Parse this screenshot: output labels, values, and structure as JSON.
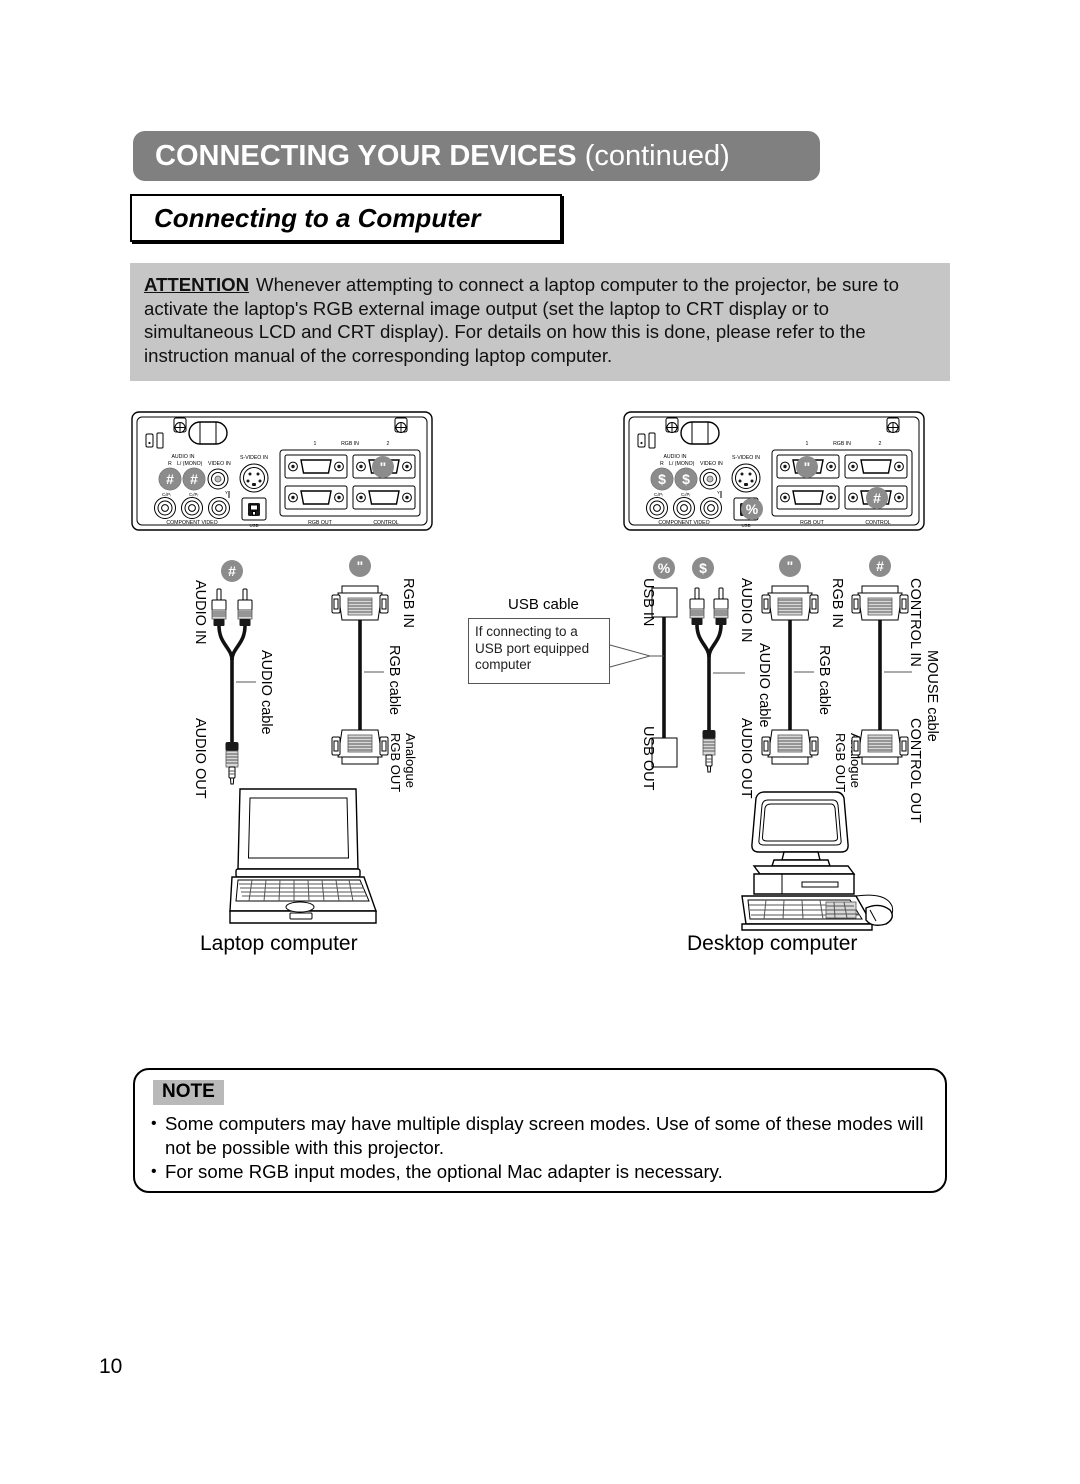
{
  "header": {
    "banner_title_main": "CONNECTING YOUR DEVICES",
    "banner_title_continued": " (continued)",
    "section_title": "Connecting to a Computer"
  },
  "attention": {
    "label": "ATTENTION",
    "body": "Whenever attempting to connect a laptop computer to the projector, be sure to activate the laptop's RGB external image output (set the laptop to CRT display or to simultaneous LCD and CRT display). For details on how this is done, please refer to the instruction manual of the corresponding laptop computer."
  },
  "projector_panel": {
    "audio_in": "AUDIO IN",
    "audio_r": "R",
    "audio_l": "L/ (MONO)",
    "video_in": "VIDEO IN",
    "s_video_in": "S-VIDEO IN",
    "cb_pb": "CB/PB",
    "cr_pr": "CR/PR",
    "y": "Y",
    "component_video": "COMPONENT  VIDEO",
    "usb": "USB",
    "rgb_in": "RGB  IN",
    "rgb_in_1": "1",
    "rgb_in_2": "2",
    "rgb_out": "RGB  OUT",
    "control": "CONTROL"
  },
  "badges": {
    "hash": "#",
    "quote": "\"",
    "dollar": "$",
    "percent": "%"
  },
  "laptop_group": {
    "caption": "Laptop computer",
    "audio_in": "AUDIO IN",
    "audio_cable": "AUDIO cable",
    "audio_out": "AUDIO OUT",
    "rgb_in": "RGB IN",
    "rgb_cable": "RGB cable",
    "rgb_out_line1": "Analogue",
    "rgb_out_line2": "RGB OUT"
  },
  "desktop_group": {
    "caption": "Desktop computer",
    "usb_in": "USB IN",
    "usb_out": "USB OUT",
    "audio_in": "AUDIO IN",
    "audio_cable": "AUDIO cable",
    "audio_out": "AUDIO OUT",
    "rgb_in": "RGB IN",
    "rgb_cable": "RGB cable",
    "rgb_out_line1": "Analogue",
    "rgb_out_line2": "RGB OUT",
    "control_in": "CONTROL IN",
    "mouse_cable": "MOUSE cable",
    "control_out": "CONTROL OUT"
  },
  "usb_callout": {
    "title": "USB cable",
    "line1": "If connecting to a",
    "line2": "USB port equipped",
    "line3": "computer"
  },
  "note": {
    "label": "NOTE",
    "bullet": "•",
    "items": [
      "Some computers may have multiple display screen modes. Use of some of these modes will not be possible with this projector.",
      "For some RGB input modes, the optional Mac adapter is necessary."
    ]
  },
  "footer": {
    "page_number": "10"
  },
  "colors": {
    "banner_gray": "#808080",
    "attention_gray": "#c6c6c6",
    "note_badge_gray": "#b9b9b9",
    "badge_gray": "#8c8c8c",
    "line_black": "#000000"
  }
}
